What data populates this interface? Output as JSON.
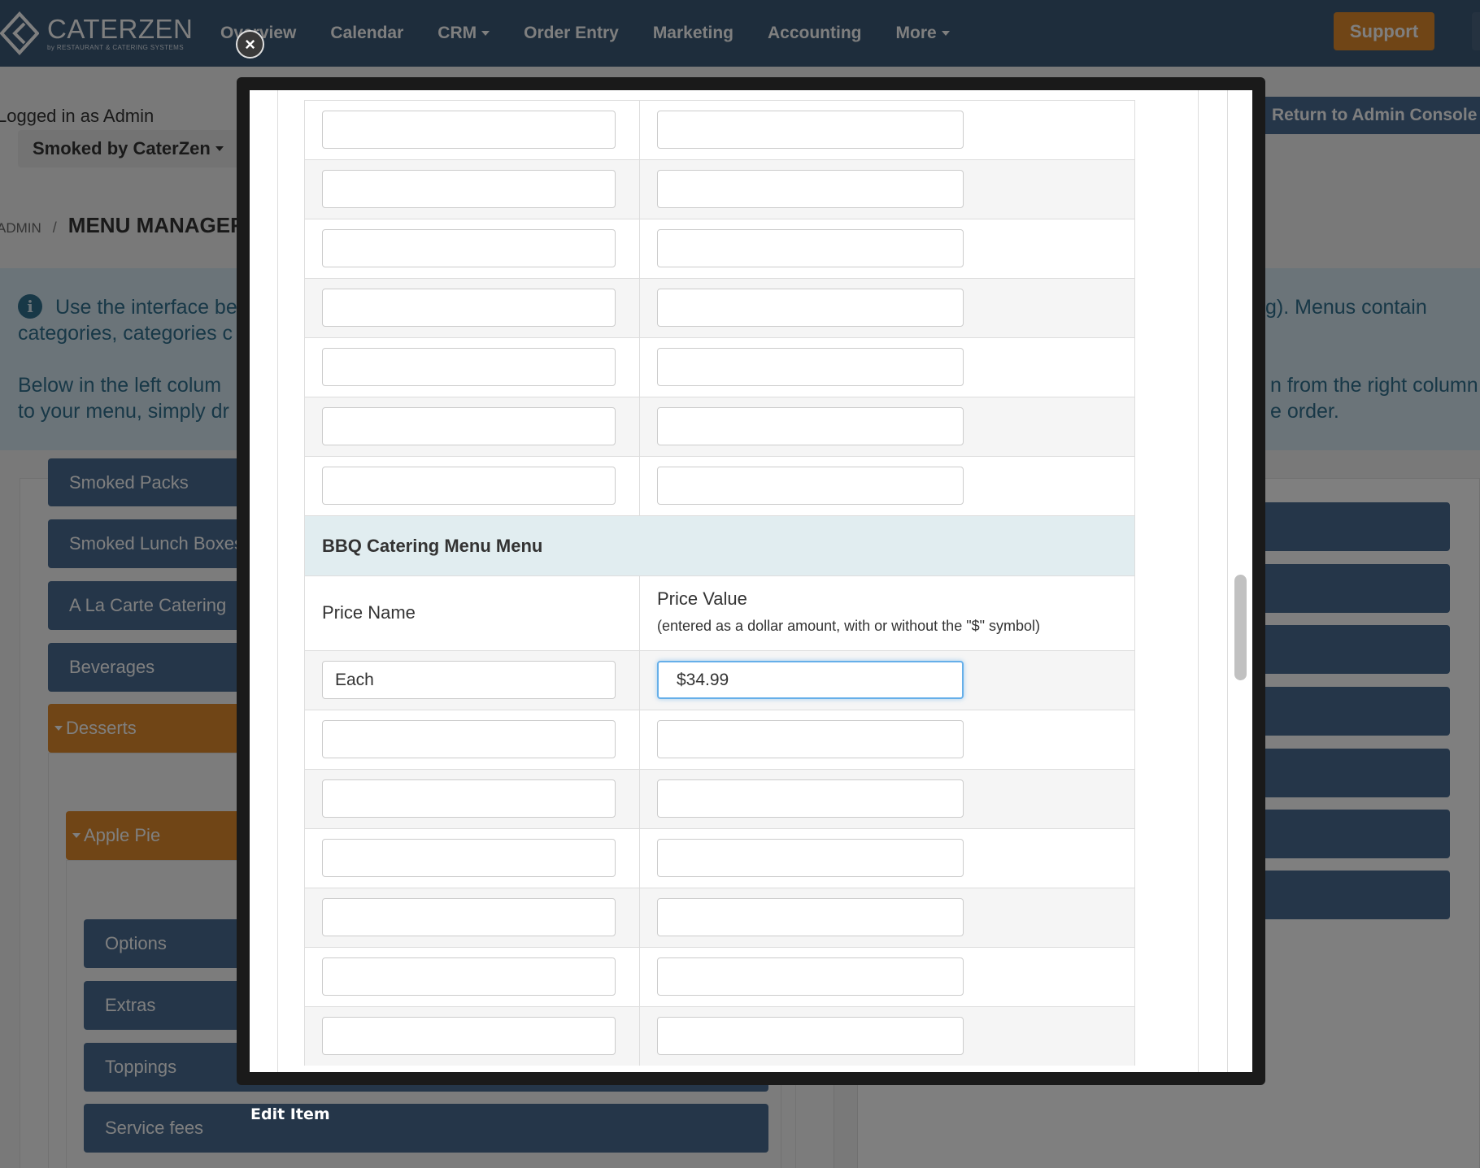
{
  "brand": {
    "name": "CATERZEN",
    "tagline": "by RESTAURANT & CATERING SYSTEMS"
  },
  "nav": {
    "items": [
      {
        "label": "Overview",
        "dropdown": false
      },
      {
        "label": "Calendar",
        "dropdown": false
      },
      {
        "label": "CRM",
        "dropdown": true
      },
      {
        "label": "Order Entry",
        "dropdown": false
      },
      {
        "label": "Marketing",
        "dropdown": false
      },
      {
        "label": "Accounting",
        "dropdown": false
      },
      {
        "label": "More",
        "dropdown": true
      }
    ],
    "support_label": "Support"
  },
  "page": {
    "logged_in": "Logged in as Admin",
    "account": "Smoked by CaterZen",
    "return_label": "Return to Admin Console",
    "breadcrumb": {
      "root": "ADMIN",
      "separator": "/",
      "current": "MENU MANAGER"
    },
    "info": {
      "line1_left": "Use the interface be",
      "line1_right": "g). Menus contain",
      "line2_left": "categories, categories c",
      "line3_left": "Below in the left colum",
      "line3_right": "n from the right column",
      "line4_left": "to your menu, simply dr",
      "line4_right": "e order."
    },
    "categories": [
      "Smoked Packs",
      "Smoked Lunch Boxes",
      "A La Carte Catering",
      "Beverages",
      "Desserts"
    ],
    "subcategory": "Apple Pie",
    "item_groups": [
      "Options",
      "Extras",
      "Toppings",
      "Service fees"
    ]
  },
  "modal": {
    "caption": "Edit Item",
    "close_glyph": "×",
    "section_title": "BBQ Catering Menu Menu",
    "col_price_name": "Price Name",
    "col_price_value": "Price Value",
    "col_price_value_note": "(entered as a dollar amount, with or without the \"$\" symbol)",
    "filled_row": {
      "name": "Each",
      "value": "$34.99"
    }
  },
  "colors": {
    "nav_bg": "#3c5a78",
    "accent_orange": "#e08a2c",
    "button_blue": "#4a6d92",
    "section_bg": "#e1edf0",
    "focus_border": "#66afe9"
  }
}
